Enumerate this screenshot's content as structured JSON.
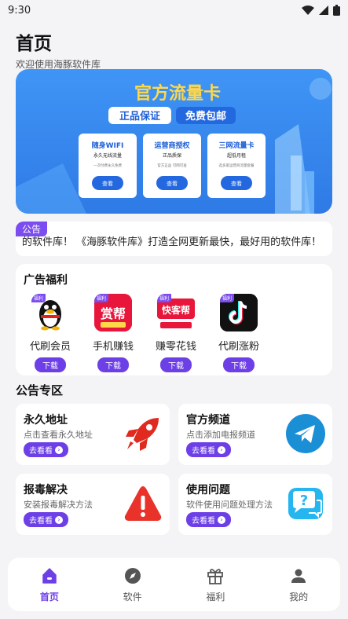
{
  "status": {
    "time": "9:30"
  },
  "header": {
    "title": "首页",
    "subtitle": "欢迎使用海豚软件库"
  },
  "banner": {
    "headline": "官方流量卡",
    "tag_left": "正品保证",
    "tag_right": "免费包邮",
    "cards": [
      {
        "title": "随身WIFI",
        "line1": "永久无线流量",
        "line2": "一次付费永久免费",
        "button": "查看"
      },
      {
        "title": "运营商授权",
        "line1": "正品质保",
        "line2": "官方正品 可网可查",
        "button": "查看"
      },
      {
        "title": "三网流量卡",
        "line1": "超低月租",
        "line2": "选多家运营商流量套餐",
        "button": "查看"
      }
    ]
  },
  "notice": {
    "tag": "公告",
    "text": "的软件库！  《海豚软件库》打造全网更新最快，最好用的软件库！"
  },
  "ads": {
    "title": "广告福利",
    "items": [
      {
        "label": "代刷会员",
        "button": "下载",
        "badge": "福利",
        "icon": "qq-penguin-icon"
      },
      {
        "label": "手机赚钱",
        "button": "下载",
        "badge": "福利",
        "icon": "zhuanbang-icon",
        "icon_text": "赏帮"
      },
      {
        "label": "赚零花钱",
        "button": "下载",
        "badge": "福利",
        "icon": "kuaikebang-icon",
        "icon_text": "快客帮"
      },
      {
        "label": "代刷涨粉",
        "button": "下载",
        "badge": "福利",
        "icon": "tiktok-icon"
      }
    ]
  },
  "section": {
    "title": "公告专区"
  },
  "cards": [
    {
      "title": "永久地址",
      "desc": "点击查看永久地址",
      "button": "去看看",
      "icon": "rocket-icon"
    },
    {
      "title": "官方频道",
      "desc": "点击添加电报频道",
      "button": "去看看",
      "icon": "telegram-icon"
    },
    {
      "title": "报毒解决",
      "desc": "安装报毒解决方法",
      "button": "去看看",
      "icon": "warning-icon"
    },
    {
      "title": "使用问题",
      "desc": "软件使用问题处理方法",
      "button": "去看看",
      "icon": "help-chat-icon"
    }
  ],
  "tabbar": {
    "tabs": [
      {
        "label": "首页",
        "icon": "home-icon",
        "active": true
      },
      {
        "label": "软件",
        "icon": "compass-icon"
      },
      {
        "label": "福利",
        "icon": "gift-icon"
      },
      {
        "label": "我的",
        "icon": "user-icon"
      }
    ]
  },
  "colors": {
    "accent": "#6d3fe6",
    "background": "#f4f4f6",
    "banner": "#3a8df0"
  }
}
